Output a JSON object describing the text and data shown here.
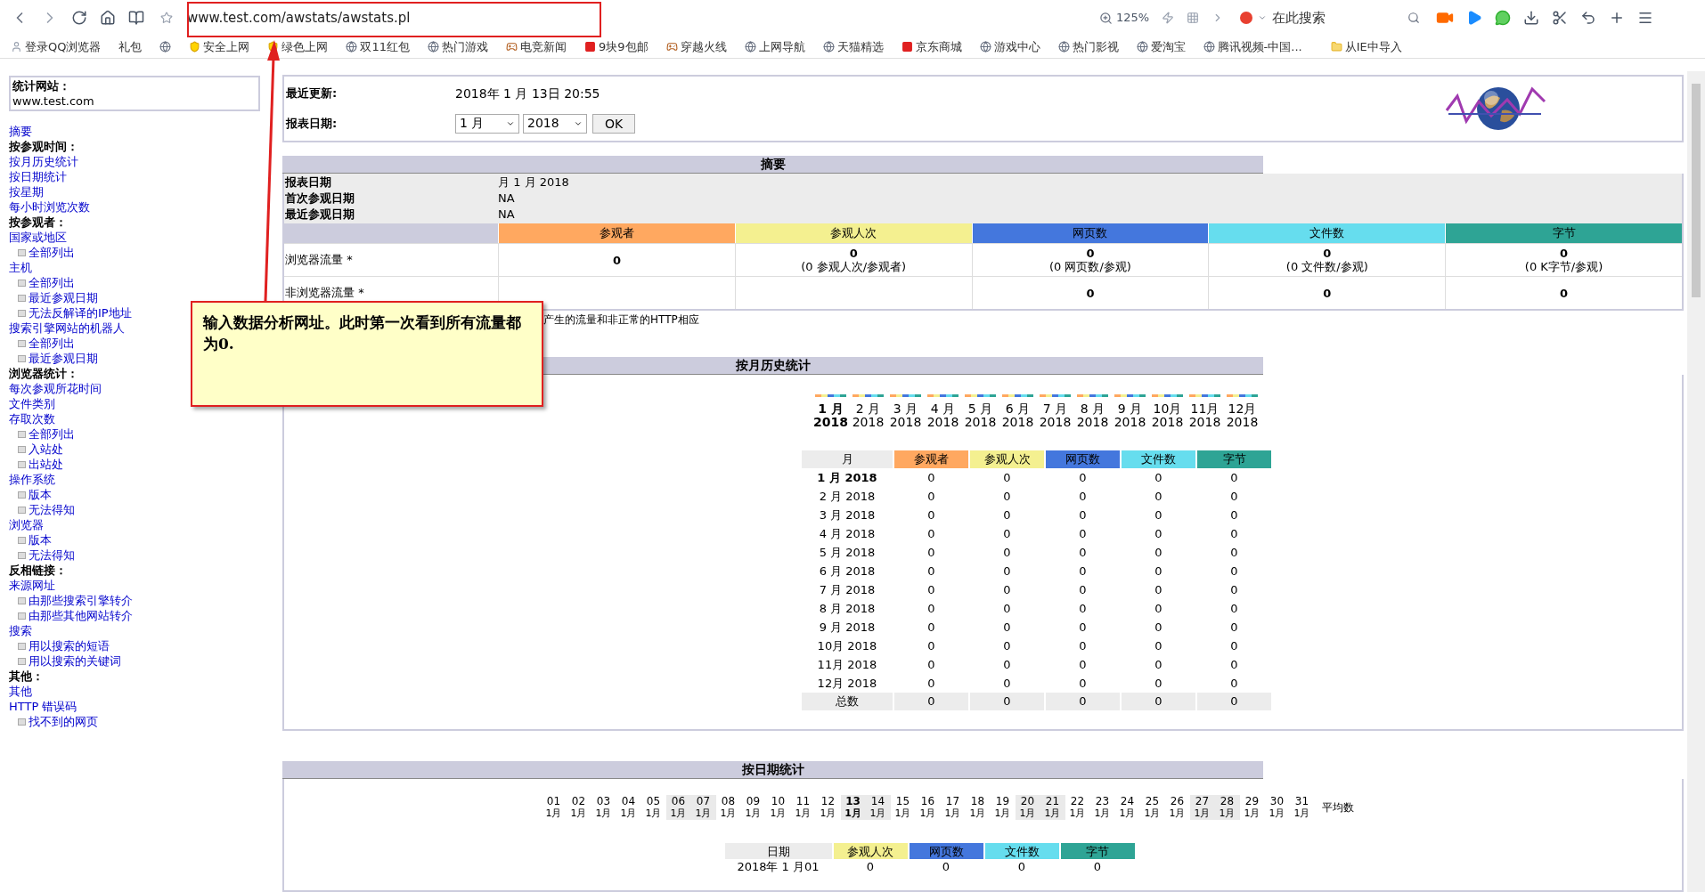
{
  "browser": {
    "url": "www.test.com/awstats/awstats.pl",
    "zoom": "125%",
    "search_placeholder": "在此搜索"
  },
  "bookmarks": [
    {
      "kind": "user",
      "label": "登录QQ浏览器"
    },
    {
      "kind": "plain",
      "label": "礼包"
    },
    {
      "kind": "site"
    },
    {
      "kind": "shield",
      "label": "安全上网"
    },
    {
      "kind": "shield",
      "label": "绿色上网"
    },
    {
      "kind": "site",
      "label": "双11红包"
    },
    {
      "kind": "site",
      "label": "热门游戏"
    },
    {
      "kind": "game",
      "label": "电竞新闻"
    },
    {
      "kind": "red",
      "label": "9块9包邮"
    },
    {
      "kind": "game",
      "label": "穿越火线"
    },
    {
      "kind": "site",
      "label": "上网导航"
    },
    {
      "kind": "site",
      "label": "天猫精选"
    },
    {
      "kind": "red",
      "label": "京东商城"
    },
    {
      "kind": "site",
      "label": "游戏中心"
    },
    {
      "kind": "site",
      "label": "热门影视"
    },
    {
      "kind": "site",
      "label": "爱淘宝"
    },
    {
      "kind": "site",
      "label": "腾讯视频-中国..."
    },
    {
      "kind": "folder",
      "label": "从IE中导入"
    }
  ],
  "sidebar": {
    "site_label": "统计网站：",
    "site_value": "www.test.com",
    "items": [
      {
        "kind": "link",
        "text": "摘要"
      },
      {
        "kind": "heading",
        "text": "按参观时间："
      },
      {
        "kind": "link",
        "text": "按月历史统计"
      },
      {
        "kind": "link",
        "text": "按日期统计"
      },
      {
        "kind": "link",
        "text": "按星期"
      },
      {
        "kind": "link",
        "text": "每小时浏览次数"
      },
      {
        "kind": "heading",
        "text": "按参观者："
      },
      {
        "kind": "link",
        "text": "国家或地区",
        "children": [
          {
            "text": "全部列出"
          }
        ]
      },
      {
        "kind": "link",
        "text": "主机",
        "children": [
          {
            "text": "全部列出"
          },
          {
            "text": "最近参观日期"
          },
          {
            "text": "无法反解译的IP地址"
          }
        ]
      },
      {
        "kind": "link",
        "text": "搜索引擎网站的机器人",
        "children": [
          {
            "text": "全部列出"
          },
          {
            "text": "最近参观日期"
          }
        ]
      },
      {
        "kind": "heading",
        "text": "浏览器统计："
      },
      {
        "kind": "link",
        "text": "每次参观所花时间"
      },
      {
        "kind": "link",
        "text": "文件类别"
      },
      {
        "kind": "link",
        "text": "存取次数",
        "children": [
          {
            "text": "全部列出"
          },
          {
            "text": "入站处"
          },
          {
            "text": "出站处"
          }
        ]
      },
      {
        "kind": "link",
        "text": "操作系统",
        "children": [
          {
            "text": "版本"
          },
          {
            "text": "无法得知"
          }
        ]
      },
      {
        "kind": "link",
        "text": "浏览器",
        "children": [
          {
            "text": "版本"
          },
          {
            "text": "无法得知"
          }
        ]
      },
      {
        "kind": "heading",
        "text": "反相链接："
      },
      {
        "kind": "link",
        "text": "来源网址",
        "children": [
          {
            "text": "由那些搜索引擎转介"
          },
          {
            "text": "由那些其他网站转介"
          }
        ]
      },
      {
        "kind": "link",
        "text": "搜索",
        "children": [
          {
            "text": "用以搜索的短语"
          },
          {
            "text": "用以搜索的关键词"
          }
        ]
      },
      {
        "kind": "heading",
        "text": "其他："
      },
      {
        "kind": "link",
        "text": "其他"
      },
      {
        "kind": "link",
        "text": "HTTP 错误码",
        "children": [
          {
            "text": "找不到的网页"
          }
        ]
      }
    ]
  },
  "header": {
    "last_update_label": "最近更新:",
    "last_update_value": "2018年 1 月 13日 20:55",
    "report_date_label": "报表日期:",
    "month_select": "1 月",
    "year_select": "2018",
    "ok_button": "OK"
  },
  "summary": {
    "title": "摘要",
    "info_rows": [
      {
        "label": "报表日期",
        "value": "月 1 月 2018"
      },
      {
        "label": "首次参观日期",
        "value": "NA"
      },
      {
        "label": "最近参观日期",
        "value": "NA"
      }
    ],
    "columns": [
      {
        "label": "参观者",
        "color": "#ffa860"
      },
      {
        "label": "参观人次",
        "color": "#f4f090"
      },
      {
        "label": "网页数",
        "color": "#4477dd"
      },
      {
        "label": "文件数",
        "color": "#66ddee"
      },
      {
        "label": "字节",
        "color": "#2ea495"
      }
    ],
    "rows": [
      {
        "label": "浏览器流量 *",
        "cells": [
          {
            "value": "0"
          },
          {
            "value": "0",
            "note": "(0 参观人次/参观者)"
          },
          {
            "value": "0",
            "note": "(0 网页数/参观)"
          },
          {
            "value": "0",
            "note": "(0 文件数/参观)"
          },
          {
            "value": "0",
            "note": "(0 K字节/参观)"
          }
        ]
      },
      {
        "label": "非浏览器流量 *",
        "cells": [
          {},
          {},
          {
            "value": "0"
          },
          {
            "value": "0"
          },
          {
            "value": "0"
          }
        ]
      }
    ],
    "footnote": "产生的流量和非正常的HTTP相应"
  },
  "monthly": {
    "title": "按月历史统计",
    "months": [
      {
        "month": "1 月",
        "year": "2018",
        "selected": true
      },
      {
        "month": "2 月",
        "year": "2018",
        "selected": false
      },
      {
        "month": "3 月",
        "year": "2018",
        "selected": false
      },
      {
        "month": "4 月",
        "year": "2018",
        "selected": false
      },
      {
        "month": "5 月",
        "year": "2018",
        "selected": false
      },
      {
        "month": "6 月",
        "year": "2018",
        "selected": false
      },
      {
        "month": "7 月",
        "year": "2018",
        "selected": false
      },
      {
        "month": "8 月",
        "year": "2018",
        "selected": false
      },
      {
        "month": "9 月",
        "year": "2018",
        "selected": false
      },
      {
        "month": "10月",
        "year": "2018",
        "selected": false
      },
      {
        "month": "11月",
        "year": "2018",
        "selected": false
      },
      {
        "month": "12月",
        "year": "2018",
        "selected": false
      }
    ],
    "first_column": "月",
    "columns": [
      {
        "label": "参观者",
        "color": "#ffa860"
      },
      {
        "label": "参观人次",
        "color": "#f4f090"
      },
      {
        "label": "网页数",
        "color": "#4477dd"
      },
      {
        "label": "文件数",
        "color": "#66ddee"
      },
      {
        "label": "字节",
        "color": "#2ea495"
      }
    ],
    "rows": [
      {
        "label": "1 月 2018",
        "selected": true,
        "values": [
          "0",
          "0",
          "0",
          "0",
          "0"
        ]
      },
      {
        "label": "2 月 2018",
        "selected": false,
        "values": [
          "0",
          "0",
          "0",
          "0",
          "0"
        ]
      },
      {
        "label": "3 月 2018",
        "selected": false,
        "values": [
          "0",
          "0",
          "0",
          "0",
          "0"
        ]
      },
      {
        "label": "4 月 2018",
        "selected": false,
        "values": [
          "0",
          "0",
          "0",
          "0",
          "0"
        ]
      },
      {
        "label": "5 月 2018",
        "selected": false,
        "values": [
          "0",
          "0",
          "0",
          "0",
          "0"
        ]
      },
      {
        "label": "6 月 2018",
        "selected": false,
        "values": [
          "0",
          "0",
          "0",
          "0",
          "0"
        ]
      },
      {
        "label": "7 月 2018",
        "selected": false,
        "values": [
          "0",
          "0",
          "0",
          "0",
          "0"
        ]
      },
      {
        "label": "8 月 2018",
        "selected": false,
        "values": [
          "0",
          "0",
          "0",
          "0",
          "0"
        ]
      },
      {
        "label": "9 月 2018",
        "selected": false,
        "values": [
          "0",
          "0",
          "0",
          "0",
          "0"
        ]
      },
      {
        "label": "10月 2018",
        "selected": false,
        "values": [
          "0",
          "0",
          "0",
          "0",
          "0"
        ]
      },
      {
        "label": "11月 2018",
        "selected": false,
        "values": [
          "0",
          "0",
          "0",
          "0",
          "0"
        ]
      },
      {
        "label": "12月 2018",
        "selected": false,
        "values": [
          "0",
          "0",
          "0",
          "0",
          "0"
        ]
      }
    ],
    "total": {
      "label": "总数",
      "values": [
        "0",
        "0",
        "0",
        "0",
        "0"
      ]
    }
  },
  "daily": {
    "title": "按日期统计",
    "days": [
      {
        "day": "01",
        "month": "1月",
        "weekend": false,
        "selected": false
      },
      {
        "day": "02",
        "month": "1月",
        "weekend": false,
        "selected": false
      },
      {
        "day": "03",
        "month": "1月",
        "weekend": false,
        "selected": false
      },
      {
        "day": "04",
        "month": "1月",
        "weekend": false,
        "selected": false
      },
      {
        "day": "05",
        "month": "1月",
        "weekend": false,
        "selected": false
      },
      {
        "day": "06",
        "month": "1月",
        "weekend": true,
        "selected": false
      },
      {
        "day": "07",
        "month": "1月",
        "weekend": true,
        "selected": false
      },
      {
        "day": "08",
        "month": "1月",
        "weekend": false,
        "selected": false
      },
      {
        "day": "09",
        "month": "1月",
        "weekend": false,
        "selected": false
      },
      {
        "day": "10",
        "month": "1月",
        "weekend": false,
        "selected": false
      },
      {
        "day": "11",
        "month": "1月",
        "weekend": false,
        "selected": false
      },
      {
        "day": "12",
        "month": "1月",
        "weekend": false,
        "selected": false
      },
      {
        "day": "13",
        "month": "1月",
        "weekend": true,
        "selected": true
      },
      {
        "day": "14",
        "month": "1月",
        "weekend": true,
        "selected": false
      },
      {
        "day": "15",
        "month": "1月",
        "weekend": false,
        "selected": false
      },
      {
        "day": "16",
        "month": "1月",
        "weekend": false,
        "selected": false
      },
      {
        "day": "17",
        "month": "1月",
        "weekend": false,
        "selected": false
      },
      {
        "day": "18",
        "month": "1月",
        "weekend": false,
        "selected": false
      },
      {
        "day": "19",
        "month": "1月",
        "weekend": false,
        "selected": false
      },
      {
        "day": "20",
        "month": "1月",
        "weekend": true,
        "selected": false
      },
      {
        "day": "21",
        "month": "1月",
        "weekend": true,
        "selected": false
      },
      {
        "day": "22",
        "month": "1月",
        "weekend": false,
        "selected": false
      },
      {
        "day": "23",
        "month": "1月",
        "weekend": false,
        "selected": false
      },
      {
        "day": "24",
        "month": "1月",
        "weekend": false,
        "selected": false
      },
      {
        "day": "25",
        "month": "1月",
        "weekend": false,
        "selected": false
      },
      {
        "day": "26",
        "month": "1月",
        "weekend": false,
        "selected": false
      },
      {
        "day": "27",
        "month": "1月",
        "weekend": true,
        "selected": false
      },
      {
        "day": "28",
        "month": "1月",
        "weekend": true,
        "selected": false
      },
      {
        "day": "29",
        "month": "1月",
        "weekend": false,
        "selected": false
      },
      {
        "day": "30",
        "month": "1月",
        "weekend": false,
        "selected": false
      },
      {
        "day": "31",
        "month": "1月",
        "weekend": false,
        "selected": false
      }
    ],
    "average_label": "平均数",
    "first_column": "日期",
    "columns": [
      {
        "label": "参观人次",
        "color": "#f4f090"
      },
      {
        "label": "网页数",
        "color": "#4477dd"
      },
      {
        "label": "文件数",
        "color": "#66ddee"
      },
      {
        "label": "字节",
        "color": "#2ea495"
      }
    ],
    "rows": [
      {
        "label": "2018年 1 月01",
        "values": [
          "0",
          "0",
          "0",
          "0"
        ]
      }
    ]
  },
  "annotation": {
    "text": "输入数据分析网址。此时第一次看到所有流量都为0."
  }
}
